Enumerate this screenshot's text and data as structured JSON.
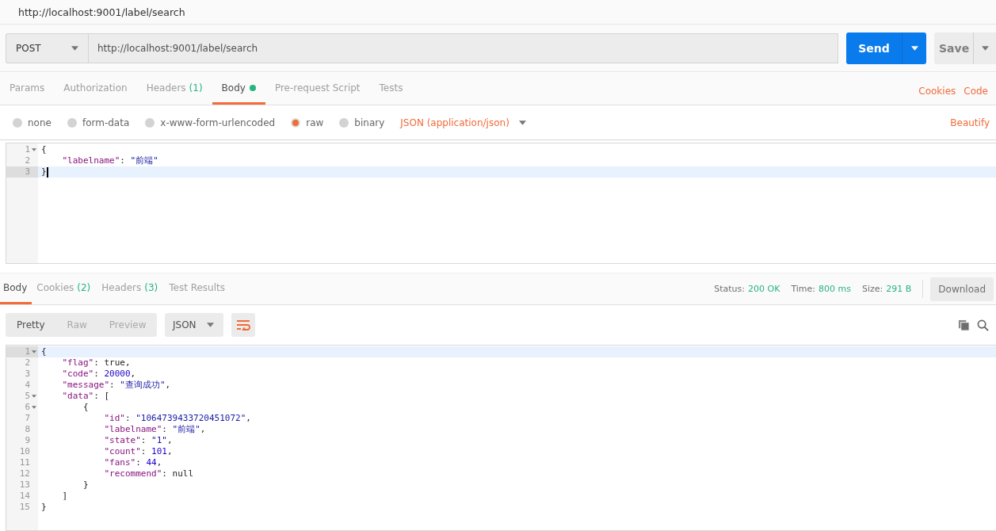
{
  "window": {
    "title": "http://localhost:9001/label/search"
  },
  "request": {
    "method": "POST",
    "url": "http://localhost:9001/label/search",
    "send": "Send",
    "save": "Save"
  },
  "request_tabs": [
    {
      "label": "Params",
      "selected": false,
      "dot": false
    },
    {
      "label": "Authorization",
      "selected": false,
      "dot": false
    },
    {
      "label": "Headers",
      "count": "(1)",
      "selected": false,
      "dot": false
    },
    {
      "label": "Body",
      "selected": true,
      "dot": true
    },
    {
      "label": "Pre-request Script",
      "selected": false,
      "dot": false
    },
    {
      "label": "Tests",
      "selected": false,
      "dot": false
    }
  ],
  "request_links": [
    "Cookies",
    "Code"
  ],
  "body_modes": [
    {
      "label": "none",
      "selected": false
    },
    {
      "label": "form-data",
      "selected": false
    },
    {
      "label": "x-www-form-urlencoded",
      "selected": false
    },
    {
      "label": "raw",
      "selected": true
    },
    {
      "label": "binary",
      "selected": false
    }
  ],
  "content_type": "JSON (application/json)",
  "beautify": "Beautify",
  "request_body": [
    {
      "number": "1",
      "foldable": true,
      "active": false,
      "cursor": false,
      "tokens": [
        {
          "kind": "punct",
          "text": "{"
        }
      ]
    },
    {
      "number": "2",
      "foldable": false,
      "active": false,
      "cursor": false,
      "tokens": [
        {
          "kind": "key",
          "text": "    \"labelname\""
        },
        {
          "kind": "punct",
          "text": ": "
        },
        {
          "kind": "string",
          "text": "\"前端\""
        }
      ]
    },
    {
      "number": "3",
      "foldable": false,
      "active": true,
      "cursor": true,
      "tokens": [
        {
          "kind": "punct",
          "text": "}"
        }
      ]
    }
  ],
  "response_tabs": [
    {
      "label": "Body",
      "selected": true
    },
    {
      "label": "Cookies",
      "count": "(2)",
      "selected": false
    },
    {
      "label": "Headers",
      "count": "(3)",
      "selected": false
    },
    {
      "label": "Test Results",
      "selected": false
    }
  ],
  "response_meta": [
    {
      "label": "Status:",
      "value": "200 OK"
    },
    {
      "label": "Time:",
      "value": "800 ms"
    },
    {
      "label": "Size:",
      "value": "291 B"
    }
  ],
  "download": "Download",
  "view_modes": [
    {
      "label": "Pretty",
      "selected": true
    },
    {
      "label": "Raw",
      "selected": false
    },
    {
      "label": "Preview",
      "selected": false
    }
  ],
  "format": "JSON",
  "response_body": [
    {
      "number": "1",
      "foldable": true,
      "active": true,
      "cursor": false,
      "tokens": [
        {
          "kind": "punct",
          "text": "{"
        }
      ]
    },
    {
      "number": "2",
      "foldable": false,
      "active": false,
      "cursor": false,
      "tokens": [
        {
          "kind": "key",
          "text": "    \"flag\""
        },
        {
          "kind": "punct",
          "text": ": "
        },
        {
          "kind": "keyword",
          "text": "true"
        },
        {
          "kind": "punct",
          "text": ","
        }
      ]
    },
    {
      "number": "3",
      "foldable": false,
      "active": false,
      "cursor": false,
      "tokens": [
        {
          "kind": "key",
          "text": "    \"code\""
        },
        {
          "kind": "punct",
          "text": ": "
        },
        {
          "kind": "number",
          "text": "20000"
        },
        {
          "kind": "punct",
          "text": ","
        }
      ]
    },
    {
      "number": "4",
      "foldable": false,
      "active": false,
      "cursor": false,
      "tokens": [
        {
          "kind": "key",
          "text": "    \"message\""
        },
        {
          "kind": "punct",
          "text": ": "
        },
        {
          "kind": "string",
          "text": "\"查询成功\""
        },
        {
          "kind": "punct",
          "text": ","
        }
      ]
    },
    {
      "number": "5",
      "foldable": true,
      "active": false,
      "cursor": false,
      "tokens": [
        {
          "kind": "key",
          "text": "    \"data\""
        },
        {
          "kind": "punct",
          "text": ": ["
        }
      ]
    },
    {
      "number": "6",
      "foldable": true,
      "active": false,
      "cursor": false,
      "tokens": [
        {
          "kind": "punct",
          "text": "        {"
        }
      ]
    },
    {
      "number": "7",
      "foldable": false,
      "active": false,
      "cursor": false,
      "tokens": [
        {
          "kind": "key",
          "text": "            \"id\""
        },
        {
          "kind": "punct",
          "text": ": "
        },
        {
          "kind": "string",
          "text": "\"1064739433720451072\""
        },
        {
          "kind": "punct",
          "text": ","
        }
      ]
    },
    {
      "number": "8",
      "foldable": false,
      "active": false,
      "cursor": false,
      "tokens": [
        {
          "kind": "key",
          "text": "            \"labelname\""
        },
        {
          "kind": "punct",
          "text": ": "
        },
        {
          "kind": "string",
          "text": "\"前端\""
        },
        {
          "kind": "punct",
          "text": ","
        }
      ]
    },
    {
      "number": "9",
      "foldable": false,
      "active": false,
      "cursor": false,
      "tokens": [
        {
          "kind": "key",
          "text": "            \"state\""
        },
        {
          "kind": "punct",
          "text": ": "
        },
        {
          "kind": "string",
          "text": "\"1\""
        },
        {
          "kind": "punct",
          "text": ","
        }
      ]
    },
    {
      "number": "10",
      "foldable": false,
      "active": false,
      "cursor": false,
      "tokens": [
        {
          "kind": "key",
          "text": "            \"count\""
        },
        {
          "kind": "punct",
          "text": ": "
        },
        {
          "kind": "number",
          "text": "101"
        },
        {
          "kind": "punct",
          "text": ","
        }
      ]
    },
    {
      "number": "11",
      "foldable": false,
      "active": false,
      "cursor": false,
      "tokens": [
        {
          "kind": "key",
          "text": "            \"fans\""
        },
        {
          "kind": "punct",
          "text": ": "
        },
        {
          "kind": "number",
          "text": "44"
        },
        {
          "kind": "punct",
          "text": ","
        }
      ]
    },
    {
      "number": "12",
      "foldable": false,
      "active": false,
      "cursor": false,
      "tokens": [
        {
          "kind": "key",
          "text": "            \"recommend\""
        },
        {
          "kind": "punct",
          "text": ": "
        },
        {
          "kind": "keyword",
          "text": "null"
        }
      ]
    },
    {
      "number": "13",
      "foldable": false,
      "active": false,
      "cursor": false,
      "tokens": [
        {
          "kind": "punct",
          "text": "        }"
        }
      ]
    },
    {
      "number": "14",
      "foldable": false,
      "active": false,
      "cursor": false,
      "tokens": [
        {
          "kind": "punct",
          "text": "    ]"
        }
      ]
    },
    {
      "number": "15",
      "foldable": false,
      "active": false,
      "cursor": false,
      "tokens": [
        {
          "kind": "punct",
          "text": "}"
        }
      ]
    }
  ]
}
